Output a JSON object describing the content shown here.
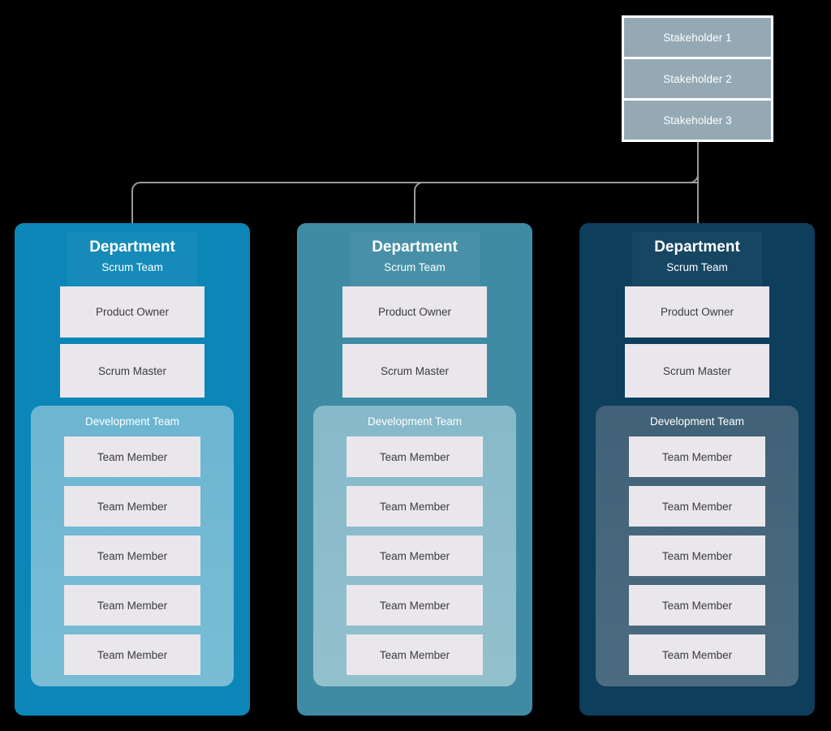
{
  "background_color": "#000000",
  "stakeholders": {
    "border_color": "#ffffff",
    "box_color": "#94a9b4",
    "items": [
      {
        "label": "Stakeholder 1"
      },
      {
        "label": "Stakeholder 2"
      },
      {
        "label": "Stakeholder 3"
      }
    ]
  },
  "connector": {
    "color": "#9a9a9a",
    "width": 2
  },
  "departments": [
    {
      "title": "Department",
      "subtitle": "Scrum Team",
      "card_color": "#0c86b6",
      "dev_panel_color": "#6cb6d2",
      "roles": [
        {
          "label": "Product Owner"
        },
        {
          "label": "Scrum Master"
        }
      ],
      "dev_team": {
        "title": "Development Team",
        "members": [
          {
            "label": "Team Member"
          },
          {
            "label": "Team Member"
          },
          {
            "label": "Team Member"
          },
          {
            "label": "Team Member"
          },
          {
            "label": "Team Member"
          }
        ]
      }
    },
    {
      "title": "Department",
      "subtitle": "Scrum Team",
      "card_color": "#3f8ba4",
      "dev_panel_color": "#86b9c9",
      "roles": [
        {
          "label": "Product Owner"
        },
        {
          "label": "Scrum Master"
        }
      ],
      "dev_team": {
        "title": "Development Team",
        "members": [
          {
            "label": "Team Member"
          },
          {
            "label": "Team Member"
          },
          {
            "label": "Team Member"
          },
          {
            "label": "Team Member"
          },
          {
            "label": "Team Member"
          }
        ]
      }
    },
    {
      "title": "Department",
      "subtitle": "Scrum Team",
      "card_color": "#0d3e5c",
      "dev_panel_color": "#416178",
      "roles": [
        {
          "label": "Product Owner"
        },
        {
          "label": "Scrum Master"
        }
      ],
      "dev_team": {
        "title": "Development Team",
        "members": [
          {
            "label": "Team Member"
          },
          {
            "label": "Team Member"
          },
          {
            "label": "Team Member"
          },
          {
            "label": "Team Member"
          },
          {
            "label": "Team Member"
          }
        ]
      }
    }
  ]
}
